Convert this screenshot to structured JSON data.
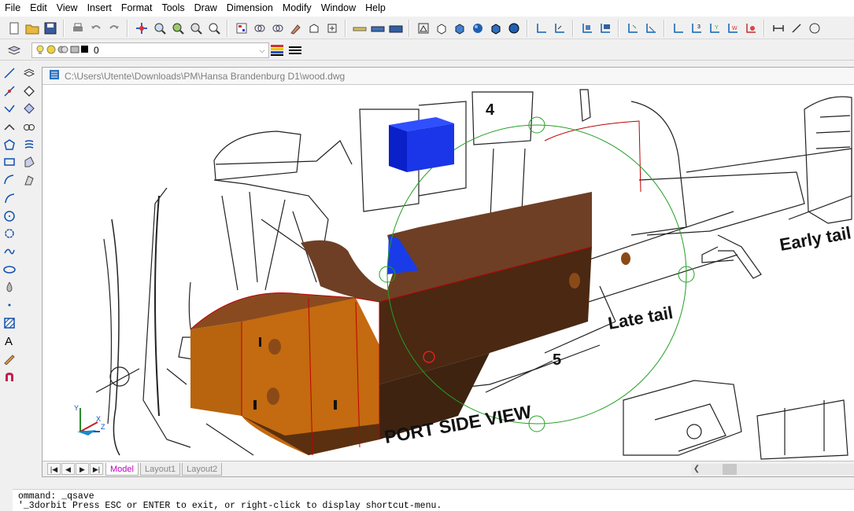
{
  "menu": [
    "File",
    "Edit",
    "View",
    "Insert",
    "Format",
    "Tools",
    "Draw",
    "Dimension",
    "Modify",
    "Window",
    "Help"
  ],
  "layer": {
    "current": "0"
  },
  "document": {
    "path": "C:\\Users\\Utente\\Downloads\\PM\\Hansa Brandenburg D1\\wood.dwg"
  },
  "drawing": {
    "labels": {
      "sheet_number": "4",
      "early_tail": "Early tail",
      "late_tail": "Late tail",
      "station": "5",
      "port_side": "PORT SIDE VIEW"
    },
    "ucs": {
      "x": "X",
      "y": "Y",
      "z": "Z"
    }
  },
  "tabs": {
    "model": "Model",
    "layout1": "Layout1",
    "layout2": "Layout2"
  },
  "command": {
    "line1": "ommand: _qsave",
    "line2": "'_3dorbit Press ESC or ENTER to exit, or right-click to display shortcut-menu."
  },
  "colors": {
    "orbit_circle": "#22a022",
    "cube": "#1414e0",
    "fuselage": "#6b3a22",
    "accent_tab": "#c000c0"
  }
}
